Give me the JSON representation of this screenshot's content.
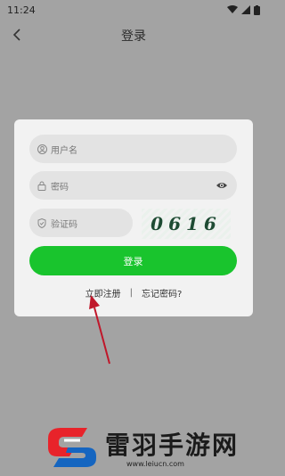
{
  "status_bar": {
    "time": "11:24"
  },
  "header": {
    "title": "登录"
  },
  "form": {
    "username": {
      "placeholder": "用户名"
    },
    "password": {
      "placeholder": "密码"
    },
    "verify_code": {
      "placeholder": "验证码"
    },
    "captcha": {
      "text": "0616"
    },
    "login_button": "登录",
    "register_link": "立即注册",
    "separator": "|",
    "forgot_link": "忘记密码?"
  },
  "watermark": {
    "title": "雷羽手游网",
    "url": "www.leiucn.com"
  },
  "colors": {
    "background": "#a3a3a3",
    "card": "#f2f2f2",
    "accent": "#19c42d",
    "arrow": "#c0172a"
  }
}
